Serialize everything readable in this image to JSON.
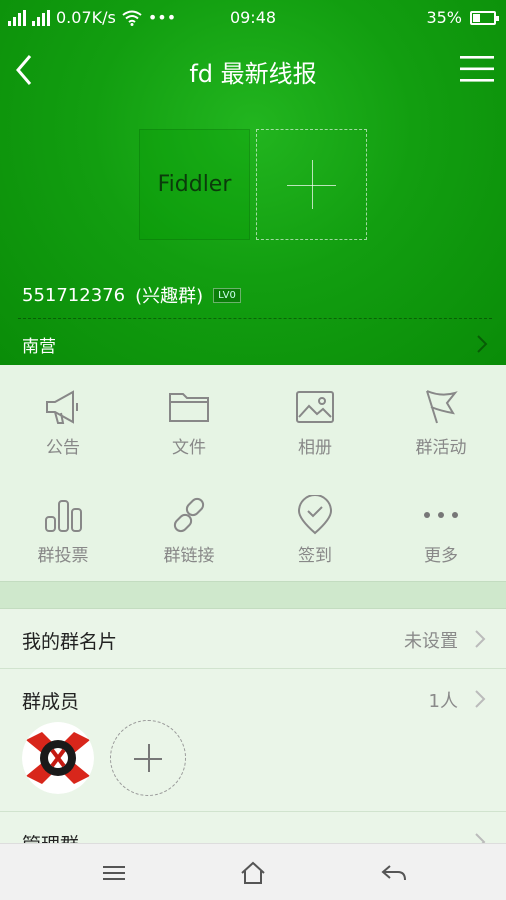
{
  "status_bar": {
    "network_speed": "0.07K/s",
    "dots": "•••",
    "time": "09:48",
    "battery": "35%"
  },
  "nav": {
    "title": "fd  最新线报",
    "back_icon": "chevron-left-icon",
    "menu_icon": "hamburger-menu-icon"
  },
  "group_header": {
    "avatar_text": "Fiddler",
    "group_number": "551712376",
    "group_type": "(兴趣群)",
    "level": "LV0",
    "location": "南营"
  },
  "features": [
    {
      "label": "公告",
      "icon": "megaphone-icon"
    },
    {
      "label": "文件",
      "icon": "folder-icon"
    },
    {
      "label": "相册",
      "icon": "photo-icon"
    },
    {
      "label": "群活动",
      "icon": "flag-icon"
    },
    {
      "label": "群投票",
      "icon": "bar-chart-icon"
    },
    {
      "label": "群链接",
      "icon": "link-icon"
    },
    {
      "label": "签到",
      "icon": "location-check-icon"
    },
    {
      "label": "更多",
      "icon": "more-dots-icon"
    }
  ],
  "rows": {
    "card_label": "我的群名片",
    "card_value": "未设置",
    "members_label": "群成员",
    "members_count": "1人",
    "admin_label": "管理群"
  },
  "colors": {
    "header_green": "#129e10",
    "background": "#e8f3e6"
  }
}
